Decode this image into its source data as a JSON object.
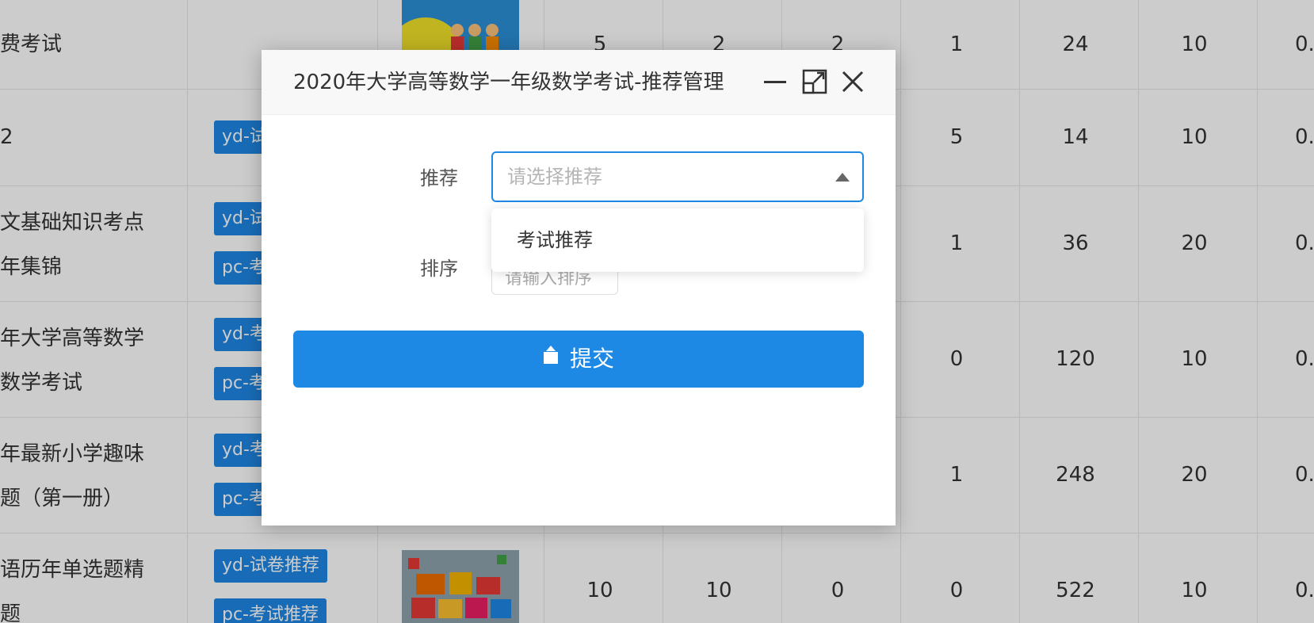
{
  "dialog": {
    "title": "2020年大学高等数学一年级数学考试-推荐管理",
    "minimize_label": "minimize",
    "maximize_label": "maximize",
    "close_label": "close",
    "recommend_label": "推荐",
    "recommend_placeholder": "请选择推荐",
    "sort_label": "排序",
    "sort_placeholder": "请输入排序",
    "dropdown_options": [
      "考试推荐"
    ],
    "submit_label": "提交"
  },
  "table": {
    "rows": [
      {
        "name_lines": [
          "费考试"
        ],
        "tags": [],
        "nums": [
          "5",
          "2",
          "2",
          "1",
          "24",
          "10",
          "0."
        ]
      },
      {
        "name_lines": [
          "2"
        ],
        "tags": [
          "yd-试"
        ],
        "nums": [
          "",
          "",
          "",
          "5",
          "14",
          "10",
          "0."
        ]
      },
      {
        "name_lines": [
          "文基础知识考点",
          "年集锦"
        ],
        "tags": [
          "yd-试",
          "pc-考"
        ],
        "nums": [
          "",
          "",
          "",
          "1",
          "36",
          "20",
          "0."
        ]
      },
      {
        "name_lines": [
          "年大学高等数学",
          "数学考试"
        ],
        "tags": [
          "yd-考",
          "pc-考"
        ],
        "nums": [
          "",
          "",
          "",
          "0",
          "120",
          "10",
          "0."
        ]
      },
      {
        "name_lines": [
          "年最新小学趣味",
          "题（第一册）"
        ],
        "tags": [
          "yd-考",
          "pc-考"
        ],
        "nums": [
          "",
          "",
          "",
          "1",
          "248",
          "20",
          "0."
        ]
      },
      {
        "name_lines": [
          "语历年单选题精",
          "题"
        ],
        "tags": [
          "yd-试卷推荐",
          "pc-考试推荐"
        ],
        "nums": [
          "10",
          "10",
          "0",
          "0",
          "522",
          "10",
          "0."
        ]
      }
    ]
  },
  "colors": {
    "primary": "#1e88e5"
  }
}
